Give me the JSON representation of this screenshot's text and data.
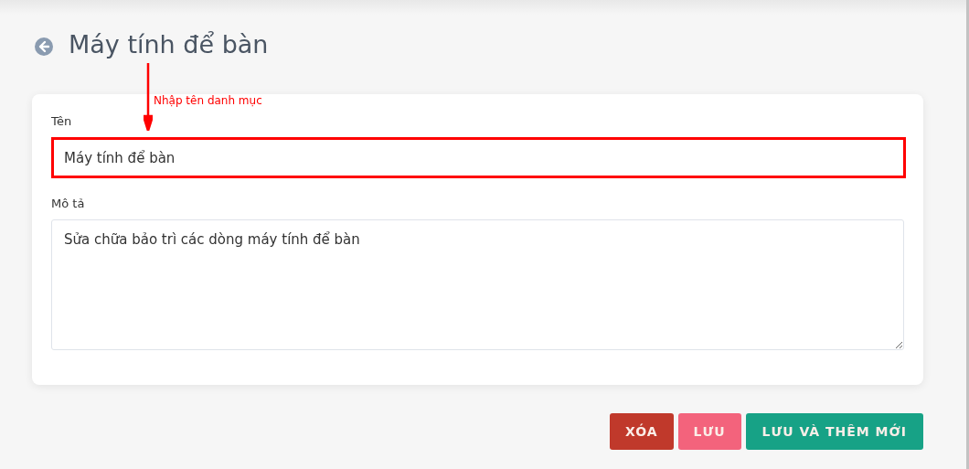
{
  "page": {
    "title": "Máy tính để bàn"
  },
  "annotation": {
    "text": "Nhập tên danh mục"
  },
  "form": {
    "fields": [
      {
        "label": "Tên",
        "kind": "input",
        "value": "Máy tính để bàn",
        "highlighted": true
      },
      {
        "label": "Mô tả",
        "kind": "textarea",
        "value": "Sửa chữa bảo trì các dòng máy tính để bàn",
        "highlighted": false
      }
    ]
  },
  "buttons": [
    {
      "label": "XÓA",
      "kind": "danger"
    },
    {
      "label": "LƯU",
      "kind": "primary"
    },
    {
      "label": "LƯU VÀ THÊM MỚI",
      "kind": "success"
    }
  ]
}
